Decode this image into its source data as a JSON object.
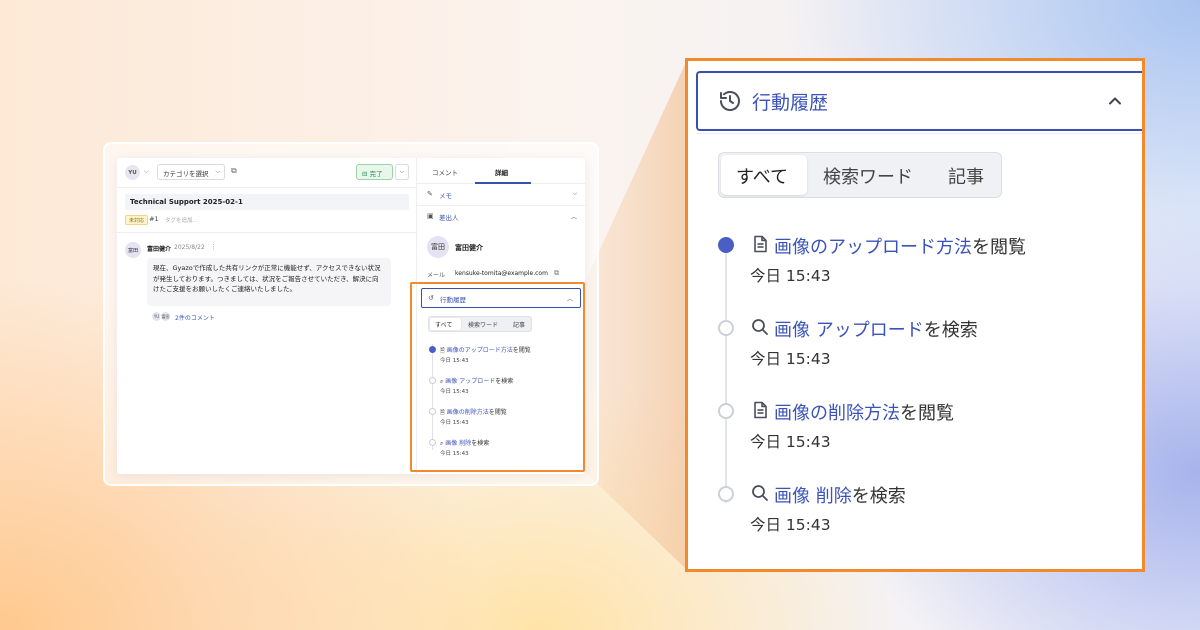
{
  "colors": {
    "highlight_border": "#f08a2d",
    "accent": "#3a53b8",
    "active_dot": "#4a5fc4",
    "done_green": "#2e8b47"
  },
  "small": {
    "toolbar": {
      "avatar": "YU",
      "category_select": "カテゴリを選択",
      "done_button": "完了"
    },
    "ticket": {
      "title": "Technical Support 2025-02-1",
      "status_tag": "未対応",
      "number": "#1",
      "tag_placeholder": "タグを追加..."
    },
    "message": {
      "avatar": "富田",
      "author": "富田健介",
      "date": "2025/8/22",
      "body": "現在、Gyazoで作成した共有リンクが正常に機能せず、アクセスできない状況が発生しております。つきましては、状況をご報告させていただき、解決に向けたご支援をお願いしたくご連絡いたしました。",
      "commenter_avatars": [
        "YU",
        "富田"
      ],
      "comments_link": "2件のコメント"
    },
    "tabs": {
      "comment": "コメント",
      "detail": "詳細"
    },
    "sections": {
      "memo": "メモ",
      "requester": "差出人"
    },
    "requester": {
      "avatar": "富田",
      "name": "富田健介",
      "mail_label": "メール",
      "mail_value": "kensuke-tomita@example.com"
    },
    "history": {
      "title": "行動履歴",
      "filters": [
        "すべて",
        "検索ワード",
        "記事"
      ],
      "items": [
        {
          "highlight": "画像のアップロード方法",
          "suffix": "を閲覧",
          "time": "今日 15:43"
        },
        {
          "highlight": "画像 アップロード",
          "suffix": "を検索",
          "time": "今日 15:43"
        },
        {
          "highlight": "画像の削除方法",
          "suffix": "を閲覧",
          "time": "今日 15:43"
        },
        {
          "highlight": "画像 削除",
          "suffix": "を検索",
          "time": "今日 15:43"
        }
      ]
    }
  },
  "zoom": {
    "title": "行動履歴",
    "filters": [
      "すべて",
      "検索ワード",
      "記事"
    ],
    "active_filter": "すべて",
    "items": [
      {
        "icon": "document-icon",
        "highlight": "画像のアップロード方法",
        "suffix": "を閲覧",
        "time": "今日 15:43",
        "active": true
      },
      {
        "icon": "search-icon",
        "highlight": "画像 アップロード",
        "suffix": "を検索",
        "time": "今日 15:43",
        "active": false
      },
      {
        "icon": "document-icon",
        "highlight": "画像の削除方法",
        "suffix": "を閲覧",
        "time": "今日 15:43",
        "active": false
      },
      {
        "icon": "search-icon",
        "highlight": "画像 削除",
        "suffix": "を検索",
        "time": "今日 15:43",
        "active": false
      }
    ]
  }
}
